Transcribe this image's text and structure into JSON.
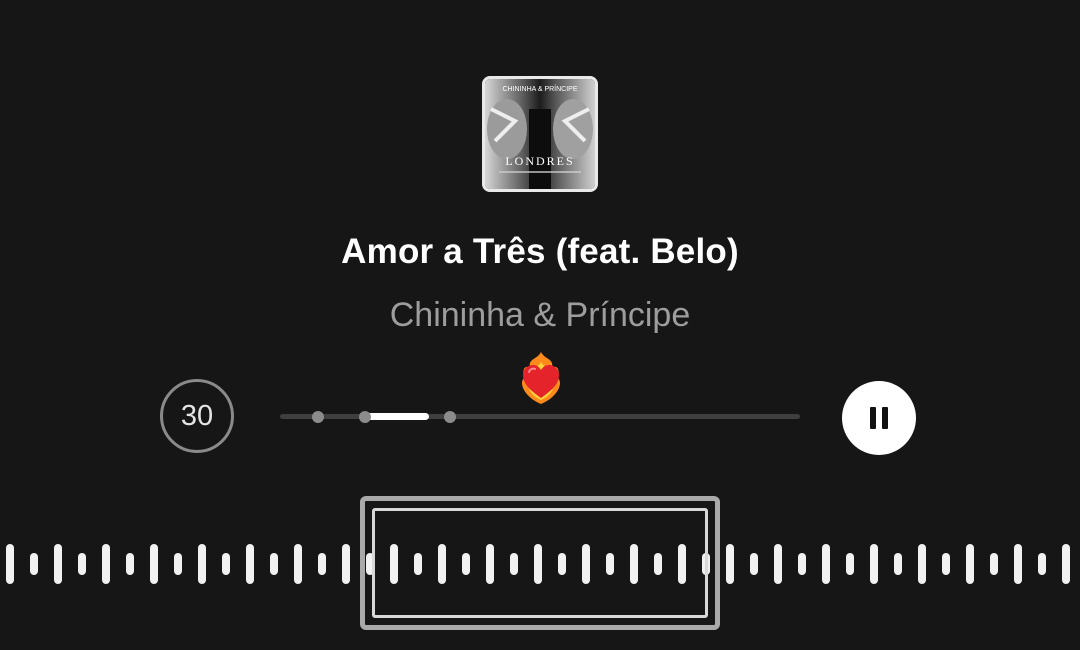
{
  "album": {
    "cover_title": "LONDRES",
    "cover_artist": "CHININHA & PRÍNCIPE"
  },
  "song": {
    "title": "Amor a Três (feat. Belo)",
    "artist": "Chininha & Príncipe"
  },
  "controls": {
    "skip_label": "30",
    "reaction_icon": "heart-on-fire-icon",
    "pause_icon": "pause-icon"
  },
  "progress": {
    "selected_start_fraction": 0.16,
    "selected_end_fraction": 0.28
  },
  "colors": {
    "background": "#161616",
    "accent": "#ffffff",
    "muted": "#9d9d9d"
  }
}
